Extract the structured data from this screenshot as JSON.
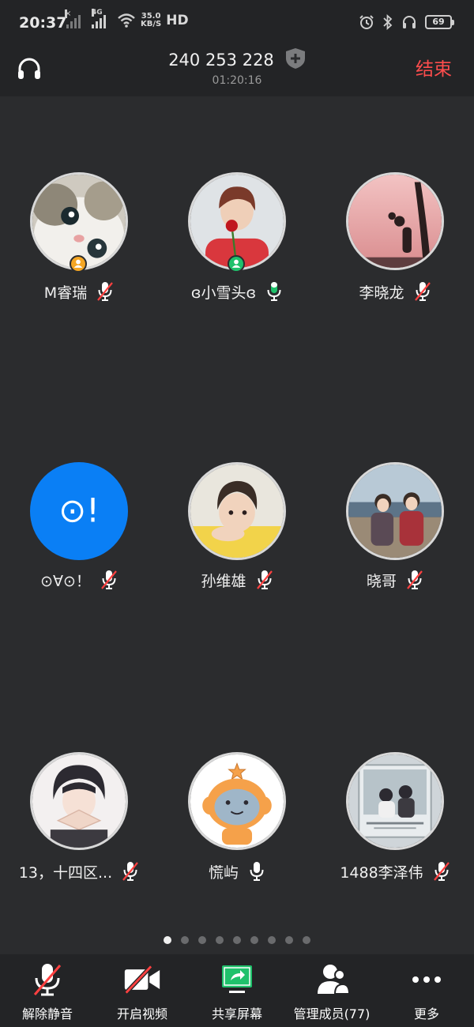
{
  "status_bar": {
    "time": "20:37",
    "network_speed_value": "35.0",
    "network_speed_unit": "KB/S",
    "hd_label": "HD",
    "battery_level": "69"
  },
  "header": {
    "meeting_id": "240 253 228",
    "duration": "01:20:16",
    "end_label": "结束"
  },
  "participants": [
    {
      "name": "M睿瑞",
      "mic": "muted",
      "badge": "host",
      "badge_color": "#f5a623"
    },
    {
      "name": "ɞ小雪头ɞ",
      "mic": "active",
      "badge": "cohost",
      "badge_color": "#1fc16b"
    },
    {
      "name": "李晓龙",
      "mic": "muted"
    },
    {
      "name": "⊙∀⊙！",
      "mic": "muted",
      "avatar_text": "⊙!"
    },
    {
      "name": "孙维雄",
      "mic": "muted"
    },
    {
      "name": "晓哥",
      "mic": "muted"
    },
    {
      "name": "13，十四区...",
      "mic": "muted"
    },
    {
      "name": "慌屿",
      "mic": "on"
    },
    {
      "name": "1488李泽伟",
      "mic": "muted"
    }
  ],
  "pager": {
    "total": 9,
    "active": 0
  },
  "toolbar": {
    "unmute_label": "解除静音",
    "video_label": "开启视频",
    "share_label": "共享屏幕",
    "manage_label": "管理成员(77)",
    "more_label": "更多"
  },
  "colors": {
    "end_red": "#ff4d4d",
    "mic_muted_red": "#ff4040",
    "share_green": "#1fc16b",
    "avatar_blue": "#0a7ff5"
  }
}
